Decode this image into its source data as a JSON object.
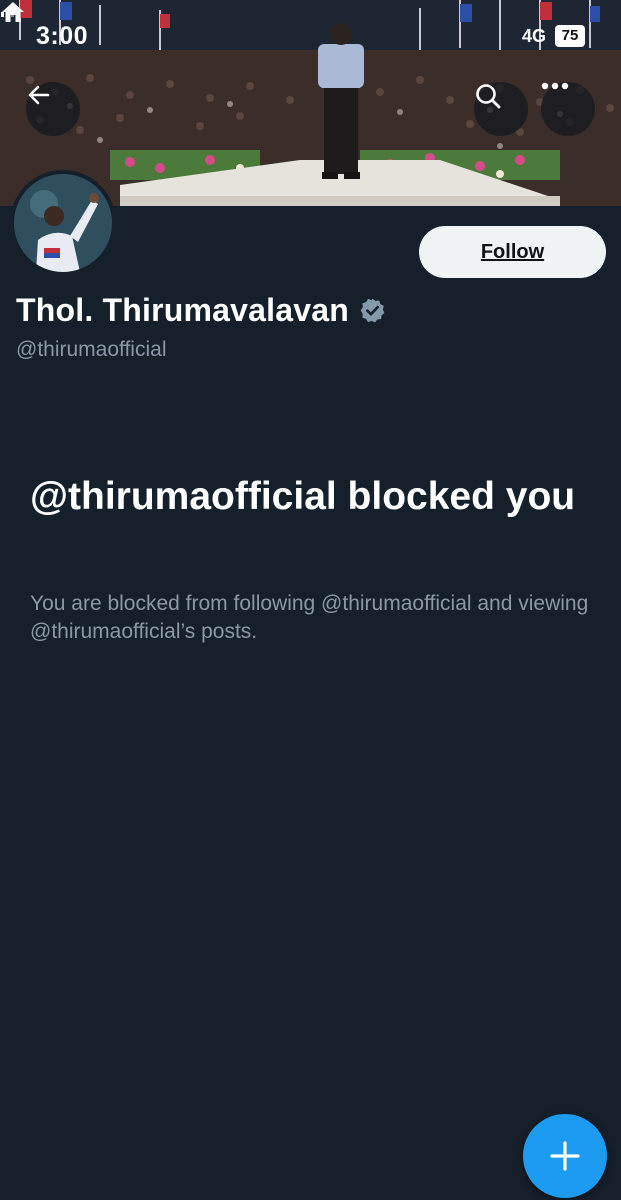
{
  "status_bar": {
    "time": "3:00",
    "network": "4G",
    "battery": "75"
  },
  "icons": {
    "home": "home-icon",
    "signal": "signal-icon",
    "back": "arrow-left-icon",
    "search": "search-icon",
    "more": "more-horizontal-icon",
    "verified": "verified-badge-icon",
    "compose": "plus-icon"
  },
  "profile": {
    "name": "Thol. Thirumavalavan",
    "handle": "@thirumaofficial",
    "follow_label": "Follow"
  },
  "blocked": {
    "title": "@thirumaofficial blocked you",
    "description": "You are blocked from following @thirumaofficial and viewing @thirumaofficial’s posts."
  },
  "colors": {
    "background": "#15202b",
    "accent": "#1d9bf0",
    "secondary_text": "#8b98a5",
    "verified": "#829aab"
  }
}
